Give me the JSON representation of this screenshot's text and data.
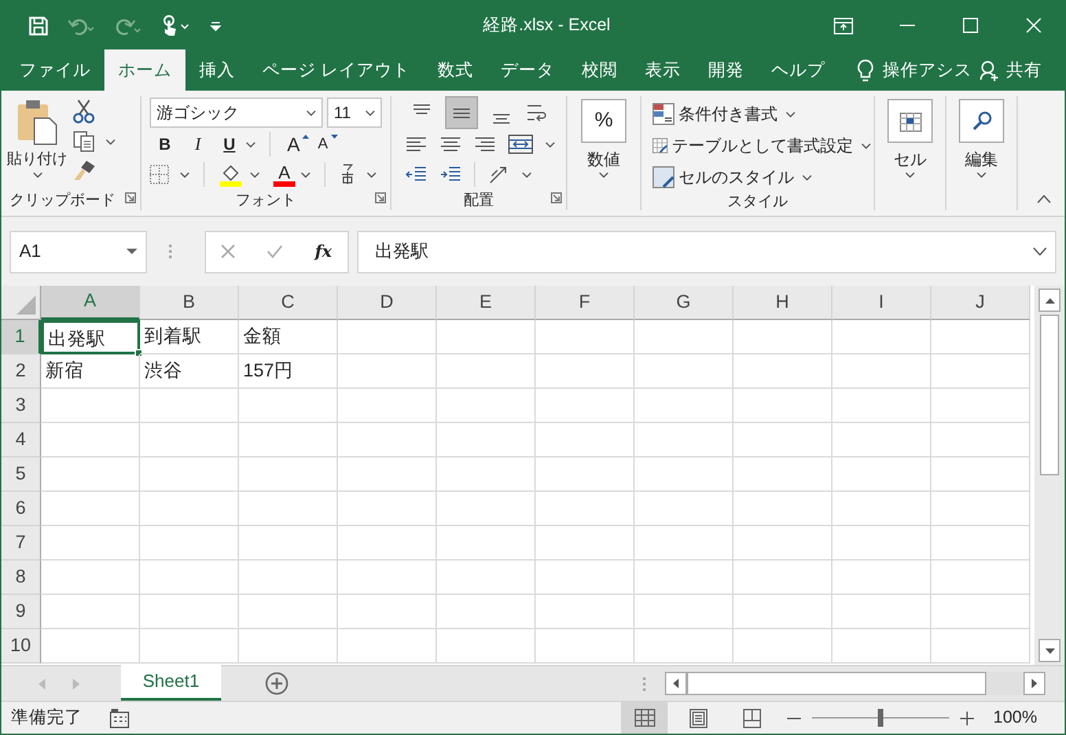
{
  "title_bar": {
    "title": "経路.xlsx - Excel"
  },
  "menu_tabs": [
    {
      "label": "ファイル",
      "selected": false
    },
    {
      "label": "ホーム",
      "selected": true
    },
    {
      "label": "挿入",
      "selected": false
    },
    {
      "label": "ページ レイアウト",
      "selected": false
    },
    {
      "label": "数式",
      "selected": false
    },
    {
      "label": "データ",
      "selected": false
    },
    {
      "label": "校閲",
      "selected": false
    },
    {
      "label": "表示",
      "selected": false
    },
    {
      "label": "開発",
      "selected": false
    },
    {
      "label": "ヘルプ",
      "selected": false
    }
  ],
  "tell_me": "操作アシス",
  "share": "共有",
  "ribbon": {
    "clipboard": {
      "paste": "貼り付け",
      "label": "クリップボード"
    },
    "font": {
      "font_name": "游ゴシック",
      "font_size": "11",
      "bold": "B",
      "italic": "I",
      "underline": "U",
      "grow": "A",
      "shrink": "A",
      "font_color": "A",
      "label": "フォント"
    },
    "alignment": {
      "vertical_align": [
        {
          "selected": false
        },
        {
          "selected": true
        },
        {
          "selected": false
        }
      ],
      "label": "配置"
    },
    "number": {
      "symbol": "%",
      "label": "数値"
    },
    "styles": {
      "items": [
        "条件付き書式",
        "テーブルとして書式設定",
        "セルのスタイル"
      ],
      "label": "スタイル"
    },
    "cells": {
      "label": "セル"
    },
    "editing": {
      "label": "編集"
    }
  },
  "formula_bar": {
    "name_box": "A1",
    "fx": "fx",
    "formula": "出発駅"
  },
  "sheet": {
    "columns": [
      {
        "label": "A",
        "selected": true
      },
      {
        "label": "B",
        "selected": false
      },
      {
        "label": "C",
        "selected": false
      },
      {
        "label": "D",
        "selected": false
      },
      {
        "label": "E",
        "selected": false
      },
      {
        "label": "F",
        "selected": false
      },
      {
        "label": "G",
        "selected": false
      },
      {
        "label": "H",
        "selected": false
      },
      {
        "label": "I",
        "selected": false
      },
      {
        "label": "J",
        "selected": false
      }
    ],
    "rows": [
      {
        "label": "1",
        "selected": true,
        "cells": [
          "出発駅",
          "到着駅",
          "金額"
        ]
      },
      {
        "label": "2",
        "selected": false,
        "cells": [
          "新宿",
          "渋谷",
          "157円"
        ]
      },
      {
        "label": "3",
        "selected": false
      },
      {
        "label": "4",
        "selected": false
      },
      {
        "label": "5",
        "selected": false
      },
      {
        "label": "6",
        "selected": false
      },
      {
        "label": "7",
        "selected": false
      },
      {
        "label": "8",
        "selected": false
      },
      {
        "label": "9",
        "selected": false
      },
      {
        "label": "10",
        "selected": false
      }
    ]
  },
  "sheet_tabs": [
    {
      "label": "Sheet1",
      "selected": true
    }
  ],
  "status_bar": {
    "status": "準備完了",
    "views": [
      {
        "kind": "normal",
        "selected": true
      },
      {
        "kind": "page_layout",
        "selected": false
      },
      {
        "kind": "page_break",
        "selected": false
      }
    ],
    "zoom_slider": {
      "level": 0.5
    },
    "zoom": "100%"
  }
}
